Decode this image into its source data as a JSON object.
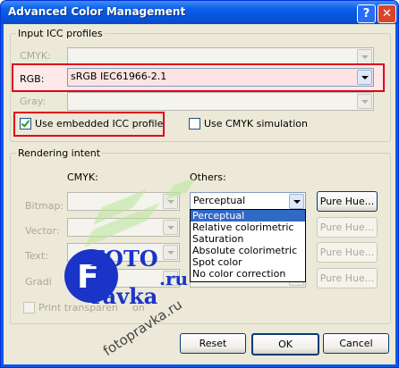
{
  "window": {
    "title": "Advanced Color Management",
    "help_label": "?",
    "close_label": "✕"
  },
  "input_profiles": {
    "legend": "Input ICC profiles",
    "cmyk_label": "CMYK:",
    "cmyk_value": "",
    "rgb_label": "RGB:",
    "rgb_value": "sRGB IEC61966-2.1",
    "gray_label": "Gray:",
    "gray_value": "",
    "embedded_label": "Use embedded ICC profile",
    "embedded_checked": true,
    "cmyk_sim_label": "Use CMYK simulation",
    "cmyk_sim_checked": false
  },
  "rendering": {
    "legend": "Rendering intent",
    "cmyk_header": "CMYK:",
    "others_header": "Others:",
    "rows": [
      {
        "label": "Bitmap:"
      },
      {
        "label": "Vector:"
      },
      {
        "label": "Text:"
      },
      {
        "label": "Gradi"
      }
    ],
    "others_selected": "Perceptual",
    "pure_hue_label": "Pure Hue...",
    "print_transparent_label": "Print transparen",
    "print_transparent_tail": "on",
    "options": [
      "Perceptual",
      "Relative colorimetric",
      "Saturation",
      "Absolute colorimetric",
      "Spot color",
      "No color correction"
    ]
  },
  "watermark": {
    "logo_text_1": "FOTO",
    "logo_text_2": "ravka",
    "logo_domain": ".ru",
    "url": "fotopravka.ru"
  },
  "buttons": {
    "reset": "Reset",
    "ok": "OK",
    "cancel": "Cancel"
  },
  "colors": {
    "highlight": "#e0001b",
    "selection": "#316ac5",
    "watermark": "#1a34c8"
  }
}
